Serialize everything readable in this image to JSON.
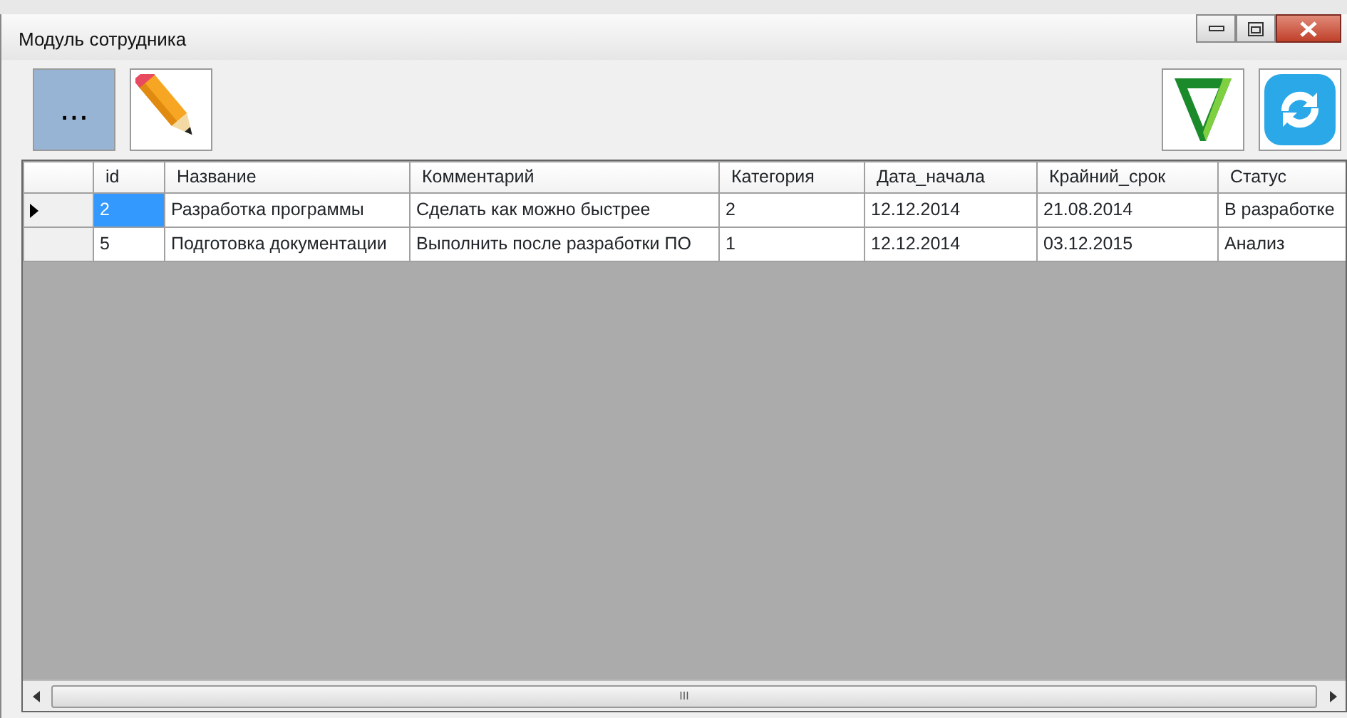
{
  "window": {
    "title": "Модуль сотрудника"
  },
  "toolbar": {
    "left": [
      {
        "kind": "ellipsis",
        "label": "...",
        "selected": true
      },
      {
        "kind": "pencil",
        "selected": false
      }
    ],
    "right": [
      {
        "kind": "filter"
      },
      {
        "kind": "refresh"
      }
    ]
  },
  "table": {
    "columns": [
      "id",
      "Название",
      "Комментарий",
      "Категория",
      "Дата_начала",
      "Крайний_срок",
      "Статус"
    ],
    "rows": [
      {
        "current": true,
        "cells": [
          {
            "text": "2",
            "selected": true
          },
          {
            "text": "Разработка программы",
            "selected": false
          },
          {
            "text": "Сделать как можно быстрее",
            "selected": false
          },
          {
            "text": "2",
            "selected": false
          },
          {
            "text": "12.12.2014",
            "selected": false
          },
          {
            "text": "21.08.2014",
            "selected": false
          },
          {
            "text": "В разработке",
            "selected": false
          }
        ]
      },
      {
        "current": false,
        "cells": [
          {
            "text": "5",
            "selected": false
          },
          {
            "text": "Подготовка документации",
            "selected": false
          },
          {
            "text": "Выполнить после разработки ПО",
            "selected": false
          },
          {
            "text": "1",
            "selected": false
          },
          {
            "text": "12.12.2014",
            "selected": false
          },
          {
            "text": "03.12.2015",
            "selected": false
          },
          {
            "text": "Анализ",
            "selected": false
          }
        ]
      }
    ]
  },
  "scrollbar": {
    "grip": "III"
  }
}
